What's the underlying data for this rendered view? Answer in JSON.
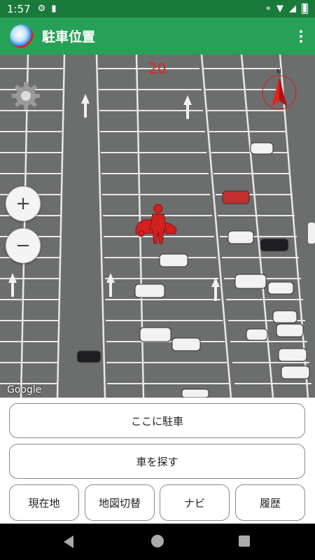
{
  "status_bar": {
    "time": "1:57"
  },
  "app_bar": {
    "title": "駐車位置"
  },
  "map": {
    "zoom_level": "20",
    "attribution": "Google",
    "zoom_in": "+",
    "zoom_out": "−",
    "compass_label": "N"
  },
  "buttons": {
    "park_here": "ここに駐車",
    "find_car": "車を探す",
    "current_location": "現在地",
    "switch_map": "地図切替",
    "navi": "ナビ",
    "history": "履歴"
  },
  "colors": {
    "status_bar": "#1a7a3c",
    "app_bar": "#27a157",
    "zoom_text": "#e0261b",
    "marker": "#d41f1f"
  }
}
